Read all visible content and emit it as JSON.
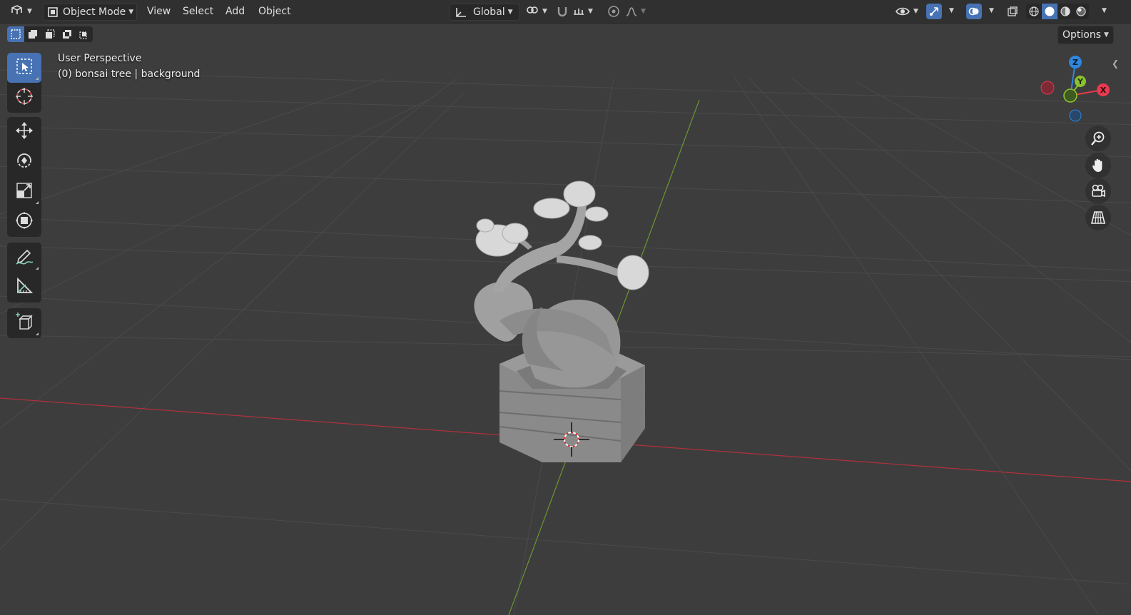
{
  "header": {
    "editor_type_icon": "3d-viewport-icon",
    "mode_label": "Object Mode",
    "menus": [
      "View",
      "Select",
      "Add",
      "Object"
    ],
    "orientation_label": "Global"
  },
  "toolbar2": {
    "options_label": "Options"
  },
  "overlay": {
    "view_name": "User Perspective",
    "object_info": "(0) bonsai tree | background"
  },
  "gizmo": {
    "axes": [
      "Z",
      "Y",
      "X"
    ],
    "colors": {
      "x": "#e8394f",
      "y": "#8bc12f",
      "z": "#2f86dc"
    }
  },
  "tools": [
    {
      "name": "select-box",
      "icon": "select-box-icon",
      "active": true
    },
    {
      "name": "cursor",
      "icon": "cursor-icon"
    },
    {
      "name": "move",
      "icon": "move-icon"
    },
    {
      "name": "rotate",
      "icon": "rotate-icon"
    },
    {
      "name": "scale",
      "icon": "scale-icon"
    },
    {
      "name": "transform",
      "icon": "transform-icon"
    },
    {
      "name": "annotate",
      "icon": "annotate-icon"
    },
    {
      "name": "measure",
      "icon": "measure-icon"
    },
    {
      "name": "add-cube",
      "icon": "add-cube-icon"
    }
  ],
  "colors": {
    "accent": "#4772b3",
    "viewport_bg": "#3d3d3d",
    "grid": "#4a4a4a",
    "x_axis": "#b5303c",
    "y_axis": "#6d9432"
  },
  "scene": {
    "object": "bonsai tree"
  }
}
